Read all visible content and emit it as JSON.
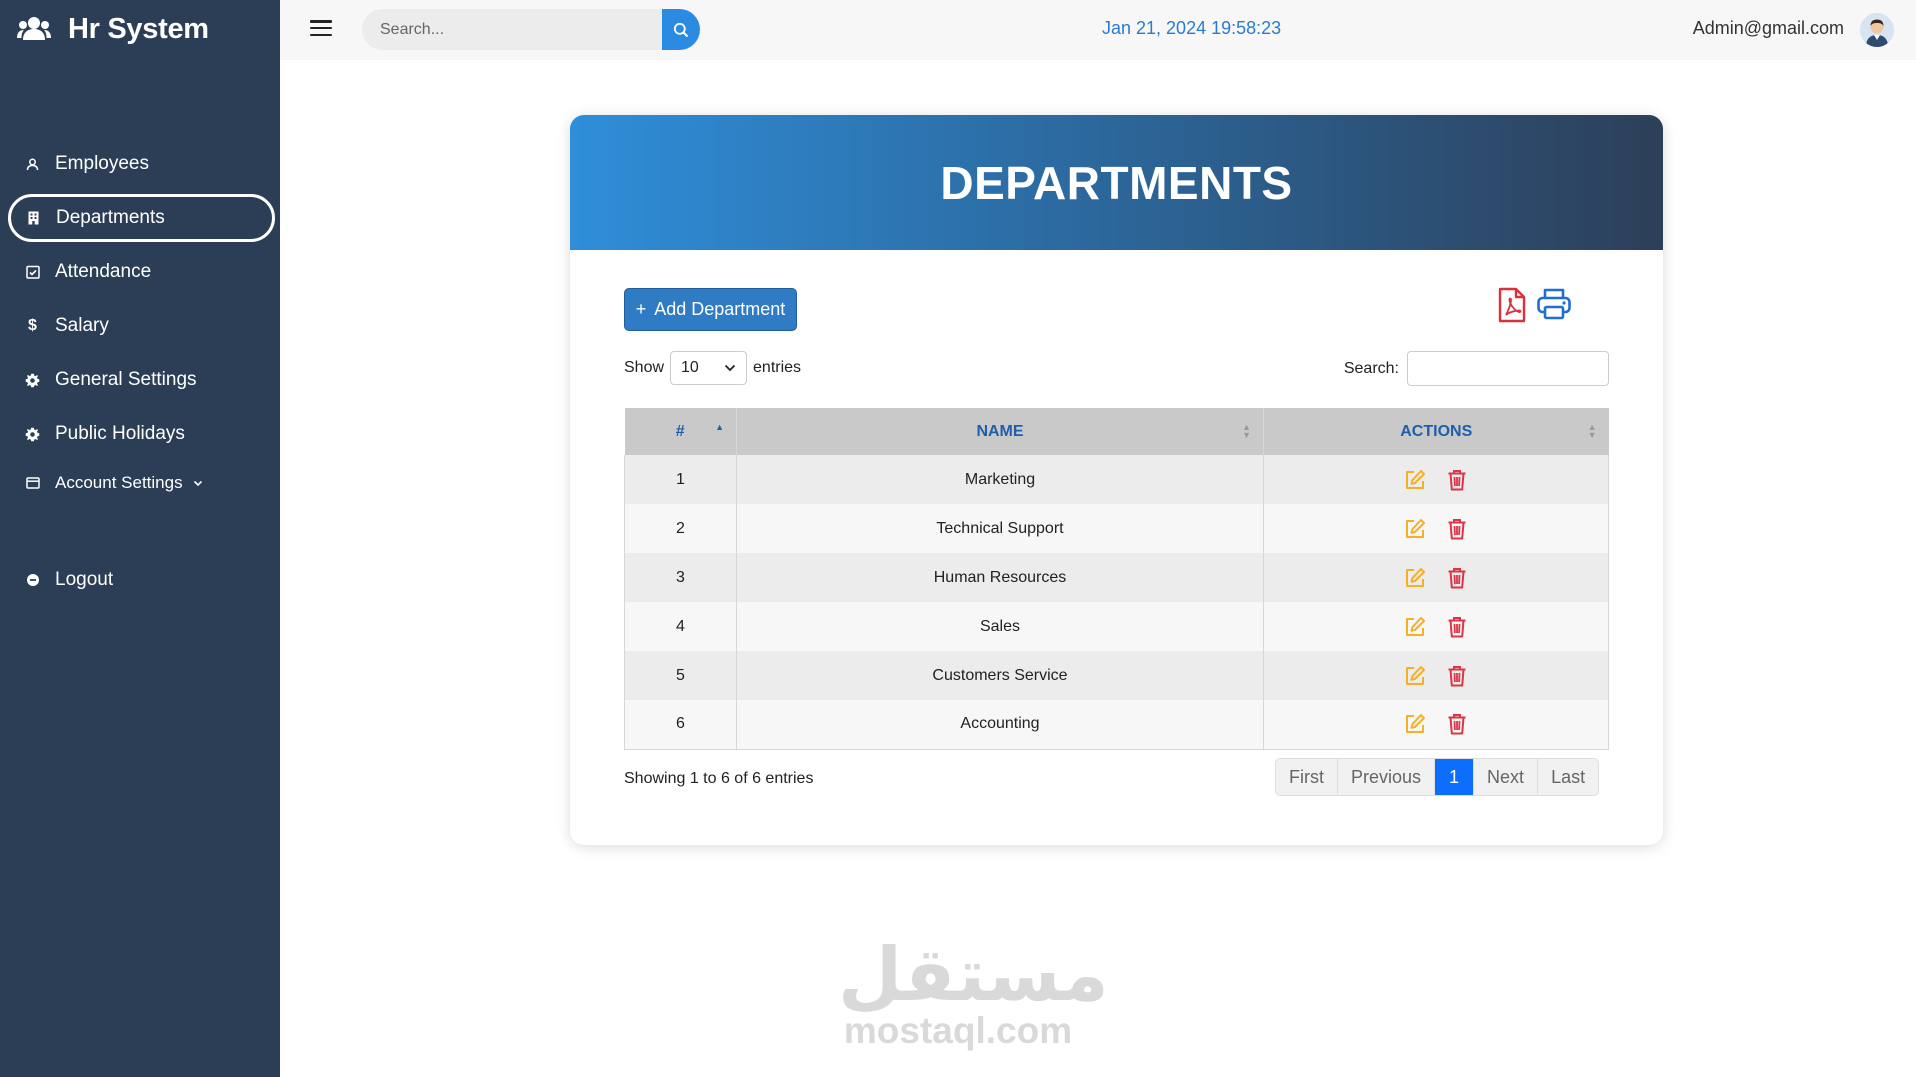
{
  "sidebar": {
    "brand": "Hr System",
    "items": [
      {
        "label": "Employees",
        "icon": "employees-icon"
      },
      {
        "label": "Departments",
        "icon": "building-icon"
      },
      {
        "label": "Attendance",
        "icon": "calendar-check-icon"
      },
      {
        "label": "Salary",
        "icon": "dollar-icon"
      },
      {
        "label": "General Settings",
        "icon": "gear-icon"
      },
      {
        "label": "Public Holidays",
        "icon": "gear-icon"
      },
      {
        "label": "Account Settings",
        "icon": "card-icon"
      },
      {
        "label": "Logout",
        "icon": "logout-icon"
      }
    ]
  },
  "topbar": {
    "search_placeholder": "Search...",
    "datetime": "Jan 21, 2024 19:58:23",
    "user_email": "Admin@gmail.com"
  },
  "card": {
    "title": "DEPARTMENTS",
    "add_button": "Add Department",
    "show_label": "Show",
    "entries_value": "10",
    "entries_label": "entries",
    "search_label": "Search:"
  },
  "table": {
    "headers": [
      "#",
      "NAME",
      "ACTIONS"
    ],
    "rows": [
      {
        "num": "1",
        "name": "Marketing"
      },
      {
        "num": "2",
        "name": "Technical Support"
      },
      {
        "num": "3",
        "name": "Human Resources"
      },
      {
        "num": "4",
        "name": "Sales"
      },
      {
        "num": "5",
        "name": "Customers Service"
      },
      {
        "num": "6",
        "name": "Accounting"
      }
    ]
  },
  "footer": {
    "info": "Showing 1 to 6 of 6 entries",
    "pager": [
      "First",
      "Previous",
      "1",
      "Next",
      "Last"
    ]
  },
  "watermark": {
    "arabic": "مستقل",
    "latin": "mostaql.com"
  },
  "colors": {
    "sidebar_bg": "#2c3e55",
    "accent_blue": "#2a8be0",
    "header_gradient_start": "#2f8ed9",
    "header_gradient_end": "#2d3f58",
    "edit_icon": "#f5b027",
    "delete_icon": "#dc3545",
    "pager_active": "#0d6efd"
  }
}
